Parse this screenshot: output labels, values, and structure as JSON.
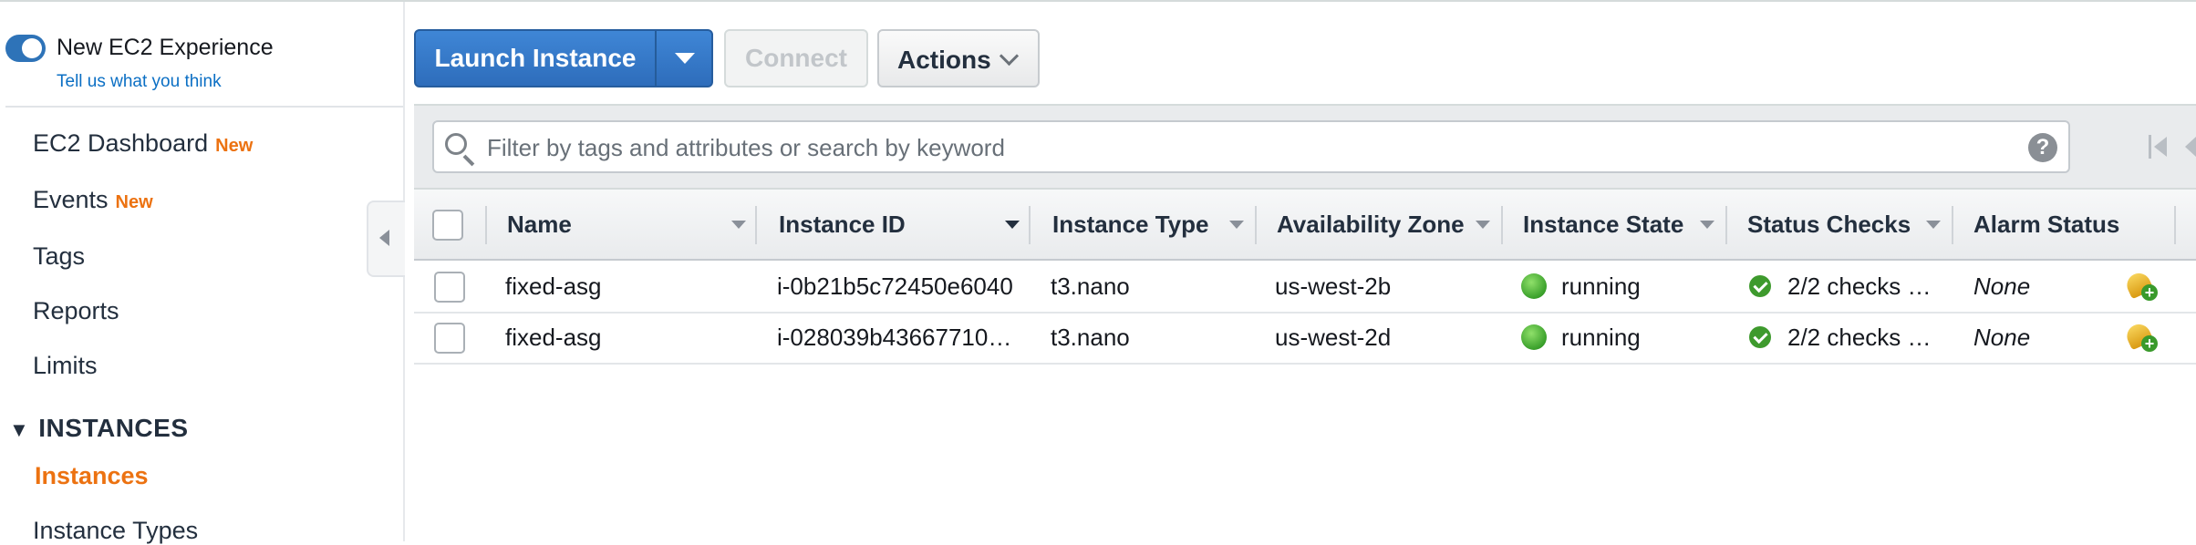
{
  "sidebar": {
    "experience_title": "New EC2 Experience",
    "experience_link": "Tell us what you think",
    "toggle_on": true,
    "items": [
      {
        "label": "EC2 Dashboard",
        "badge": "New"
      },
      {
        "label": "Events",
        "badge": "New"
      },
      {
        "label": "Tags",
        "badge": ""
      },
      {
        "label": "Reports",
        "badge": ""
      },
      {
        "label": "Limits",
        "badge": ""
      }
    ],
    "section": "INSTANCES",
    "section_items": [
      "Instances",
      "Instance Types"
    ],
    "active_item": "Instances"
  },
  "toolbar": {
    "launch_label": "Launch Instance",
    "connect_label": "Connect",
    "actions_label": "Actions"
  },
  "search": {
    "placeholder": "Filter by tags and attributes or search by keyword",
    "help_label": "?"
  },
  "table": {
    "columns": [
      "Name",
      "Instance ID",
      "Instance Type",
      "Availability Zone",
      "Instance State",
      "Status Checks",
      "Alarm Status"
    ],
    "rows": [
      {
        "name": "fixed-asg",
        "instance_id": "i-0b21b5c72450e6040",
        "instance_type": "t3.nano",
        "az": "us-west-2b",
        "state": "running",
        "status_checks": "2/2 checks …",
        "alarm_status": "None"
      },
      {
        "name": "fixed-asg",
        "instance_id": "i-028039b43667710…",
        "instance_type": "t3.nano",
        "az": "us-west-2d",
        "state": "running",
        "status_checks": "2/2 checks …",
        "alarm_status": "None"
      }
    ]
  },
  "colors": {
    "primary_button": "#2e6dbb",
    "badge_new": "#ec7211",
    "active_nav": "#ec7211",
    "link": "#0b6fc4",
    "running": "#3aa02b"
  },
  "icons": [
    "search-icon",
    "help-icon",
    "first-page-icon",
    "previous-page-icon",
    "running-status-icon",
    "status-check-icon",
    "alarm-add-icon",
    "collapse-sidebar-icon",
    "dropdown-caret-icon",
    "chevron-down-icon"
  ]
}
